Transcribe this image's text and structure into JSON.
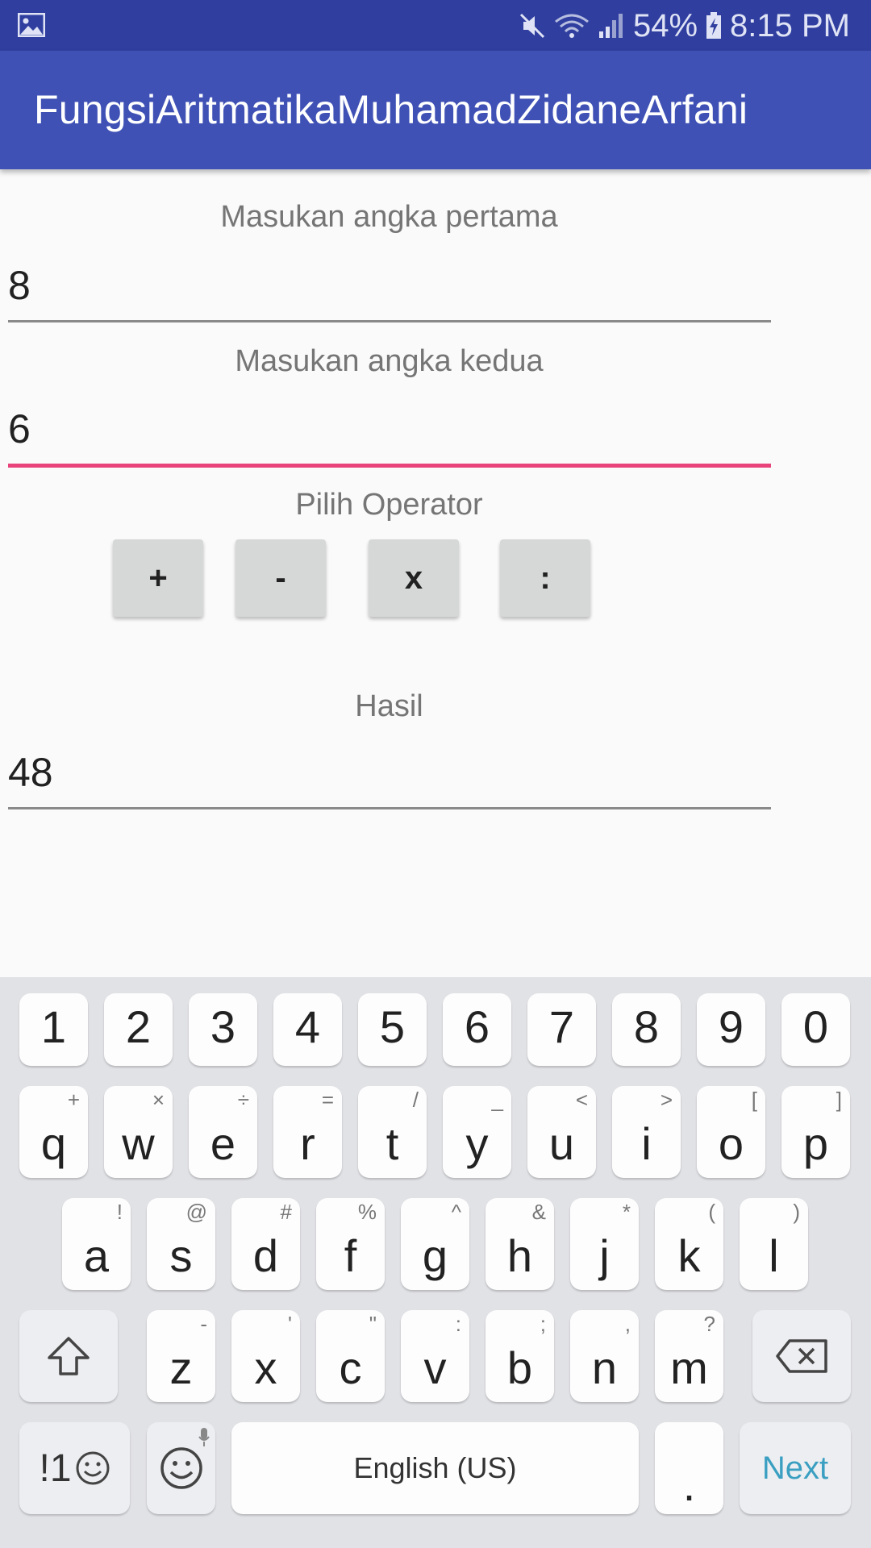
{
  "status_bar": {
    "battery": "54%",
    "time": "8:15 PM"
  },
  "app_bar": {
    "title": "FungsiAritmatikaMuhamadZidaneArfani"
  },
  "form": {
    "first_label": "Masukan angka pertama",
    "first_value": "8",
    "second_label": "Masukan angka kedua",
    "second_value": "6",
    "operator_label": "Pilih Operator",
    "operators": [
      "+",
      "-",
      "x",
      ":"
    ],
    "result_label": "Hasil",
    "result_value": "48"
  },
  "keyboard": {
    "numbers": [
      "1",
      "2",
      "3",
      "4",
      "5",
      "6",
      "7",
      "8",
      "9",
      "0"
    ],
    "row1": [
      {
        "key": "q",
        "sub": "+"
      },
      {
        "key": "w",
        "sub": "×"
      },
      {
        "key": "e",
        "sub": "÷"
      },
      {
        "key": "r",
        "sub": "="
      },
      {
        "key": "t",
        "sub": "/"
      },
      {
        "key": "y",
        "sub": "_"
      },
      {
        "key": "u",
        "sub": "<"
      },
      {
        "key": "i",
        "sub": ">"
      },
      {
        "key": "o",
        "sub": "["
      },
      {
        "key": "p",
        "sub": "]"
      }
    ],
    "row2": [
      {
        "key": "a",
        "sub": "!"
      },
      {
        "key": "s",
        "sub": "@"
      },
      {
        "key": "d",
        "sub": "#"
      },
      {
        "key": "f",
        "sub": "%"
      },
      {
        "key": "g",
        "sub": "^"
      },
      {
        "key": "h",
        "sub": "&"
      },
      {
        "key": "j",
        "sub": "*"
      },
      {
        "key": "k",
        "sub": "("
      },
      {
        "key": "l",
        "sub": ")"
      }
    ],
    "row3": [
      {
        "key": "z",
        "sub": "-"
      },
      {
        "key": "x",
        "sub": "'"
      },
      {
        "key": "c",
        "sub": "\""
      },
      {
        "key": "v",
        "sub": ":"
      },
      {
        "key": "b",
        "sub": ";"
      },
      {
        "key": "n",
        "sub": ","
      },
      {
        "key": "m",
        "sub": "?"
      }
    ],
    "symbols_label": "!1",
    "space_label": "English (US)",
    "period_label": ".",
    "next_label": "Next"
  }
}
